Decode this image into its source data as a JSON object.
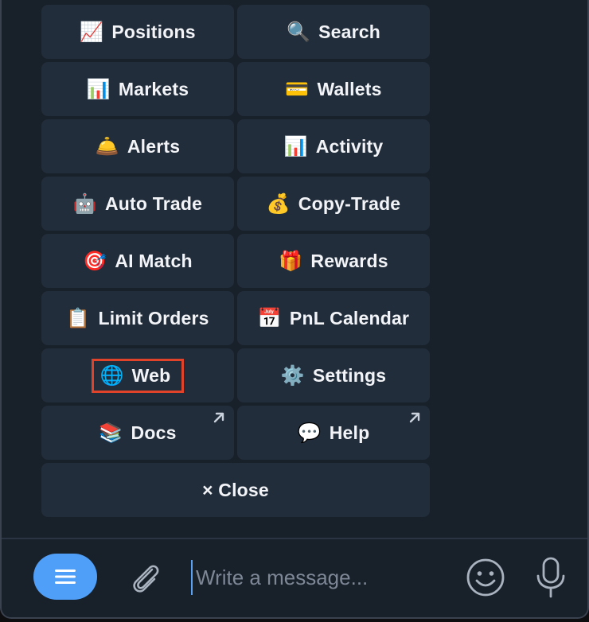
{
  "keyboard": {
    "rows": [
      [
        {
          "icon": "📈",
          "label": "Positions"
        },
        {
          "icon": "🔍",
          "label": "Search"
        }
      ],
      [
        {
          "icon": "📊",
          "label": "Markets"
        },
        {
          "icon": "💳",
          "label": "Wallets"
        }
      ],
      [
        {
          "icon": "🛎️",
          "label": "Alerts"
        },
        {
          "icon": "📊",
          "label": "Activity"
        }
      ],
      [
        {
          "icon": "🤖",
          "label": "Auto Trade"
        },
        {
          "icon": "💰",
          "label": "Copy-Trade"
        }
      ],
      [
        {
          "icon": "🎯",
          "label": "AI Match"
        },
        {
          "icon": "🎁",
          "label": "Rewards"
        }
      ],
      [
        {
          "icon": "📋",
          "label": "Limit Orders"
        },
        {
          "icon": "📅",
          "label": "PnL Calendar"
        }
      ],
      [
        {
          "icon": "🌐",
          "label": "Web"
        },
        {
          "icon": "⚙️",
          "label": "Settings"
        }
      ],
      [
        {
          "icon": "📚",
          "label": "Docs"
        },
        {
          "icon": "💬",
          "label": "Help"
        }
      ]
    ],
    "close_label": "× Close"
  },
  "composer": {
    "placeholder": "Write a message..."
  },
  "colors": {
    "background": "#18202a",
    "button": "#222d3b",
    "accent": "#4f9ef7",
    "highlight": "#e0432a"
  },
  "icons": {
    "menu": "hamburger-icon",
    "attach": "paperclip-icon",
    "emoji": "smiley-icon",
    "mic": "microphone-icon",
    "external": "external-link-arrow-icon"
  }
}
